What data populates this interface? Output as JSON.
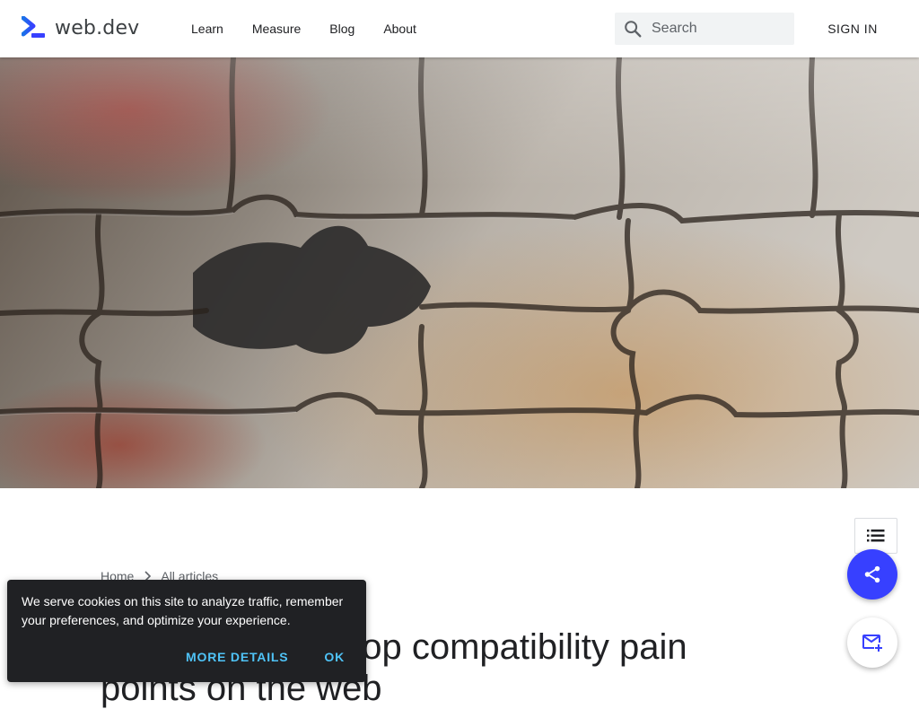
{
  "header": {
    "logo_text": "web.dev",
    "nav": [
      "Learn",
      "Measure",
      "Blog",
      "About"
    ],
    "search_placeholder": "Search",
    "signin_label": "SIGN IN"
  },
  "breadcrumb": {
    "items": [
      "Home",
      "All articles"
    ]
  },
  "article": {
    "title": "Eliminating five top compatibility pain points on the web"
  },
  "cookie": {
    "text": "We serve cookies on this site to analyze traffic, remember your preferences, and optimize your experience.",
    "more_label": "MORE DETAILS",
    "ok_label": "OK"
  },
  "icons": {
    "logo": "web-dev-logo-icon",
    "search": "search-icon",
    "breadcrumb_separator": "chevron-right-icon",
    "toc": "list-icon",
    "share": "share-icon",
    "subscribe": "mail-add-icon"
  },
  "colors": {
    "accent": "#3740ff",
    "cookie_bg": "#202124",
    "cookie_action": "#4fc3f7"
  }
}
